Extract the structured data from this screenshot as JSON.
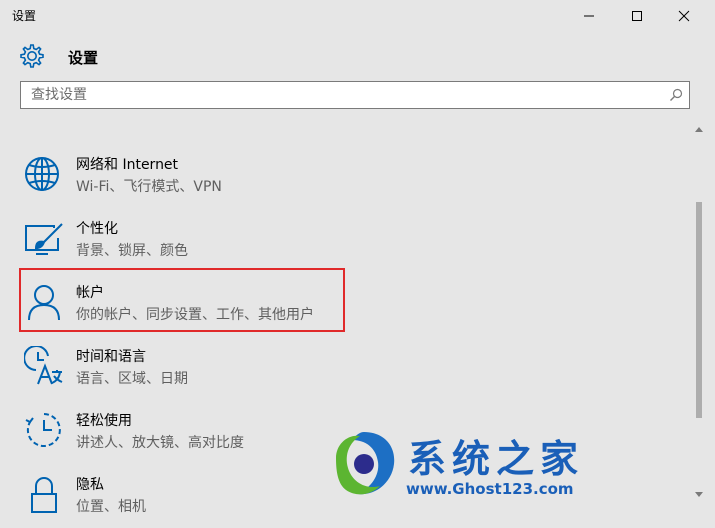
{
  "window": {
    "title": "设置",
    "controls": [
      "minimize-icon",
      "maximize-icon",
      "close-icon"
    ]
  },
  "header": {
    "title": "设置",
    "icon": "gear-icon"
  },
  "search": {
    "placeholder": "查找设置",
    "value": "",
    "icon": "search-icon"
  },
  "items": [
    {
      "title": "网络和 Internet",
      "subtitle": "Wi-Fi、飞行模式、VPN",
      "icon": "globe-icon"
    },
    {
      "title": "个性化",
      "subtitle": "背景、锁屏、颜色",
      "icon": "personalize-icon"
    },
    {
      "title": "帐户",
      "subtitle": "你的帐户、同步设置、工作、其他用户",
      "icon": "person-icon",
      "highlighted": true
    },
    {
      "title": "时间和语言",
      "subtitle": "语言、区域、日期",
      "icon": "time-language-icon"
    },
    {
      "title": "轻松使用",
      "subtitle": "讲述人、放大镜、高对比度",
      "icon": "ease-of-access-icon"
    },
    {
      "title": "隐私",
      "subtitle": "位置、相机",
      "icon": "lock-icon"
    }
  ],
  "colors": {
    "accent": "#0063b1",
    "highlight_border": "#e0292a",
    "background": "#e6e6e6"
  },
  "watermark": {
    "name": "系统之家",
    "url": "www.Ghost123.com"
  }
}
